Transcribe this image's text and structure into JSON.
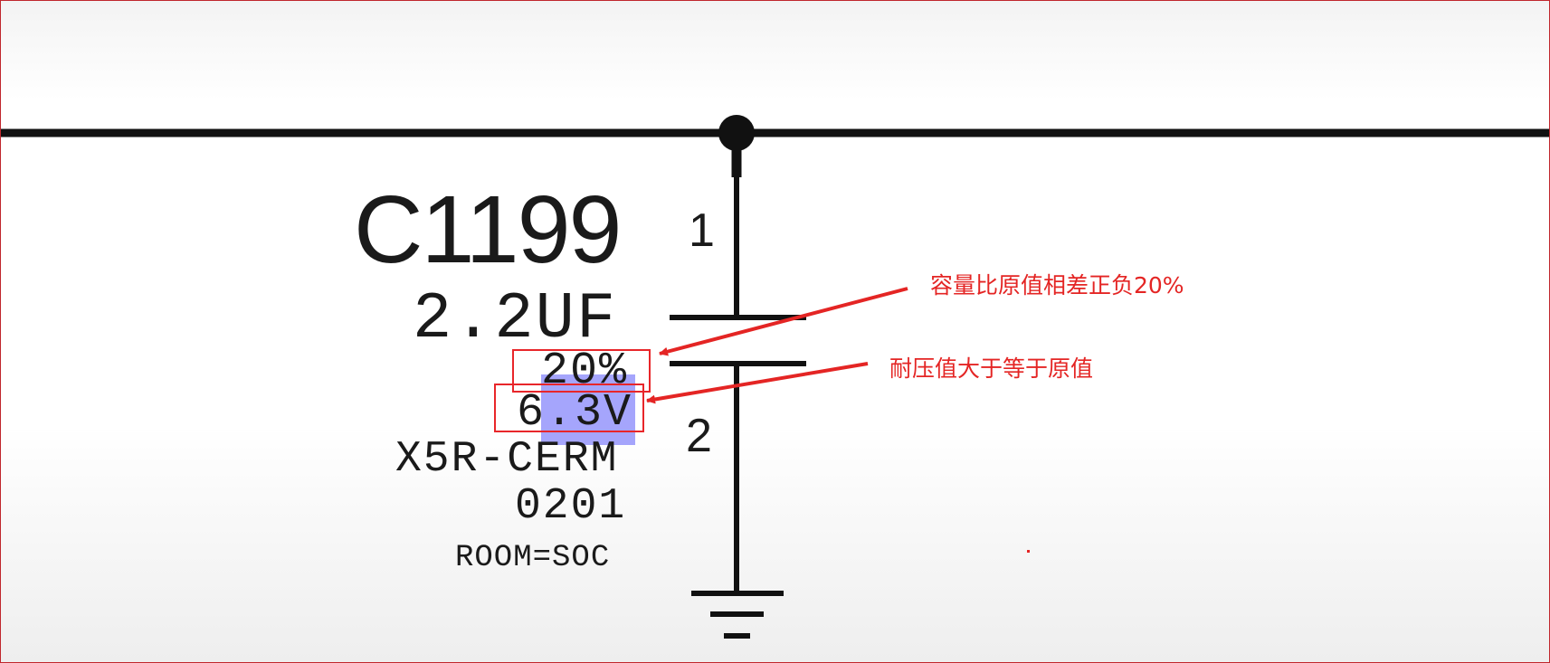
{
  "component": {
    "reference": "C1199",
    "pin_top": "1",
    "pin_bottom": "2",
    "value": "2.2UF",
    "tolerance": "20%",
    "voltage": "6.3V",
    "dielectric": "X5R-CERM",
    "package": "0201",
    "room": "ROOM=SOC"
  },
  "annotations": {
    "tolerance_note": "容量比原值相差正负20%",
    "voltage_note": "耐压值大于等于原值"
  },
  "colors": {
    "wire": "#111111",
    "annotation": "#e42524",
    "selection_highlight": "#6e6efa"
  }
}
